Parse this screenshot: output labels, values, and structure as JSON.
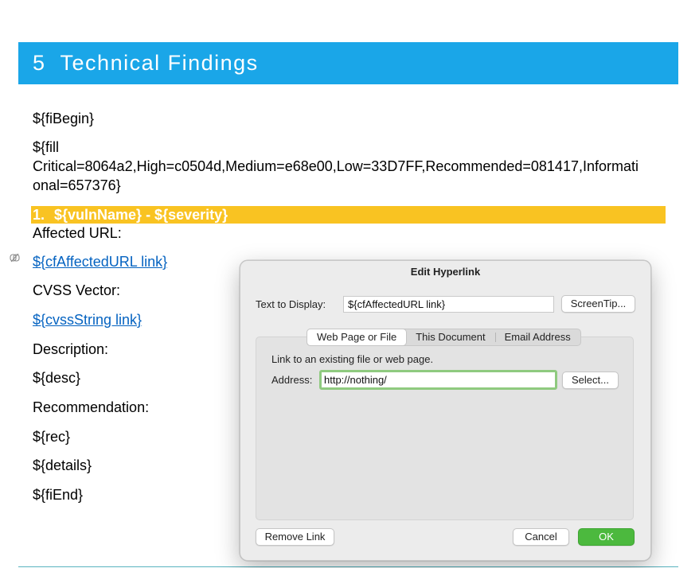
{
  "document": {
    "heading_number": "5",
    "heading_title": "Technical Findings",
    "lines": {
      "fi_begin": "${fiBegin}",
      "fill_line1": "${fill",
      "fill_line2": "Critical=8064a2,High=c0504d,Medium=e68e00,Low=33D7FF,Recommended=081417,Informati",
      "fill_line3": "onal=657376}",
      "affected_url_label": "Affected URL:",
      "affected_url_link": "${cfAffectedURL link}",
      "cvss_vector_label": "CVSS Vector:",
      "cvss_link": "${cvssString link}",
      "description_label": "Description:",
      "desc": "${desc}",
      "recommendation_label": "Recommendation:",
      "rec": "${rec}",
      "details": "${details}",
      "fi_end": "${fiEnd}"
    },
    "severity_heading": {
      "number": "1.",
      "text": "${vulnName} - ${severity}"
    }
  },
  "dialog": {
    "title": "Edit Hyperlink",
    "text_to_display_label": "Text to Display:",
    "text_to_display_value": "${cfAffectedURL link}",
    "screentip_button": "ScreenTip...",
    "tabs": [
      {
        "label": "Web Page or File",
        "active": true
      },
      {
        "label": "This Document",
        "active": false
      },
      {
        "label": "Email Address",
        "active": false
      }
    ],
    "instruction": "Link to an existing file or web page.",
    "address_label": "Address:",
    "address_value": "http://nothing/",
    "select_button": "Select...",
    "remove_link_button": "Remove Link",
    "cancel_button": "Cancel",
    "ok_button": "OK"
  },
  "colors": {
    "heading_bg": "#1aa6e8",
    "severity_bar_bg": "#f9c322",
    "link": "#0563c1",
    "ok_button": "#4cb93e",
    "address_focus": "#8fca7f"
  }
}
